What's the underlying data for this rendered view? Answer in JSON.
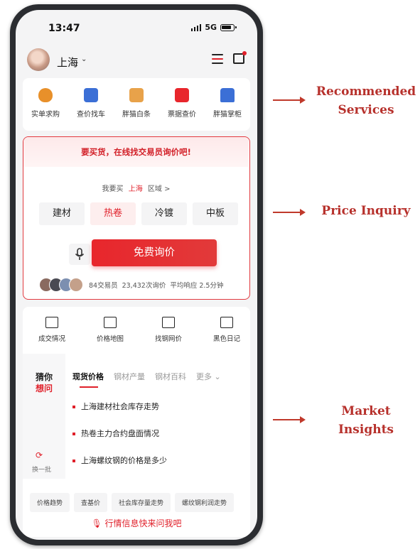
{
  "status_bar": {
    "time": "13:47",
    "network": "5G"
  },
  "header": {
    "city": "上海"
  },
  "services": {
    "items": [
      {
        "label": "实单求购",
        "icon": "money-bag-icon",
        "color": "#e8902a"
      },
      {
        "label": "查价找车",
        "icon": "truck-icon",
        "color": "#3b6fd6"
      },
      {
        "label": "胖猫白条",
        "icon": "note-icon",
        "color": "#e8a24a"
      },
      {
        "label": "票据查价",
        "icon": "receipt-icon",
        "color": "#e8262c"
      },
      {
        "label": "胖猫掌柜",
        "icon": "shop-icon",
        "color": "#3b6fd6"
      }
    ]
  },
  "inquiry": {
    "banner": "要买货，在线找交易员询价吧!",
    "want_prefix": "我要买",
    "want_city": "上海",
    "want_suffix": "区域 >",
    "chips": [
      {
        "label": "建材",
        "active": false
      },
      {
        "label": "热卷",
        "active": true
      },
      {
        "label": "冷镀",
        "active": false
      },
      {
        "label": "中板",
        "active": false
      }
    ],
    "button": "免费询价",
    "stats": {
      "traders": "84交易员",
      "inquiries": "23,432次询价",
      "response": "平均响应 2.5分钟"
    }
  },
  "insights": {
    "tools": [
      {
        "label": "成交情况",
        "icon": "deal-icon"
      },
      {
        "label": "价格地图",
        "icon": "map-icon"
      },
      {
        "label": "找钢网价",
        "icon": "chart-icon"
      },
      {
        "label": "黑色日记",
        "icon": "diary-icon"
      }
    ],
    "guess_line1": "猜你",
    "guess_line2": "想问",
    "refresh": "换一批",
    "tabs": [
      "现货价格",
      "钢材产量",
      "钢材百科",
      "更多"
    ],
    "questions": [
      "上海建材社会库存走势",
      "热卷主力合约盘面情况",
      "上海螺纹钢的价格是多少"
    ],
    "hot_tags": [
      "价格趋势",
      "查基价",
      "社会库存量走势",
      "螺纹钢利润走势"
    ],
    "ask": "行情信息快来问我吧"
  },
  "annotations": {
    "services_line1": "Recommended",
    "services_line2": "Services",
    "inquiry": "Price Inquiry",
    "insights_line1": "Market",
    "insights_line2": "Insights"
  },
  "colors": {
    "accent": "#e0202a",
    "annotation": "#b7312c"
  }
}
